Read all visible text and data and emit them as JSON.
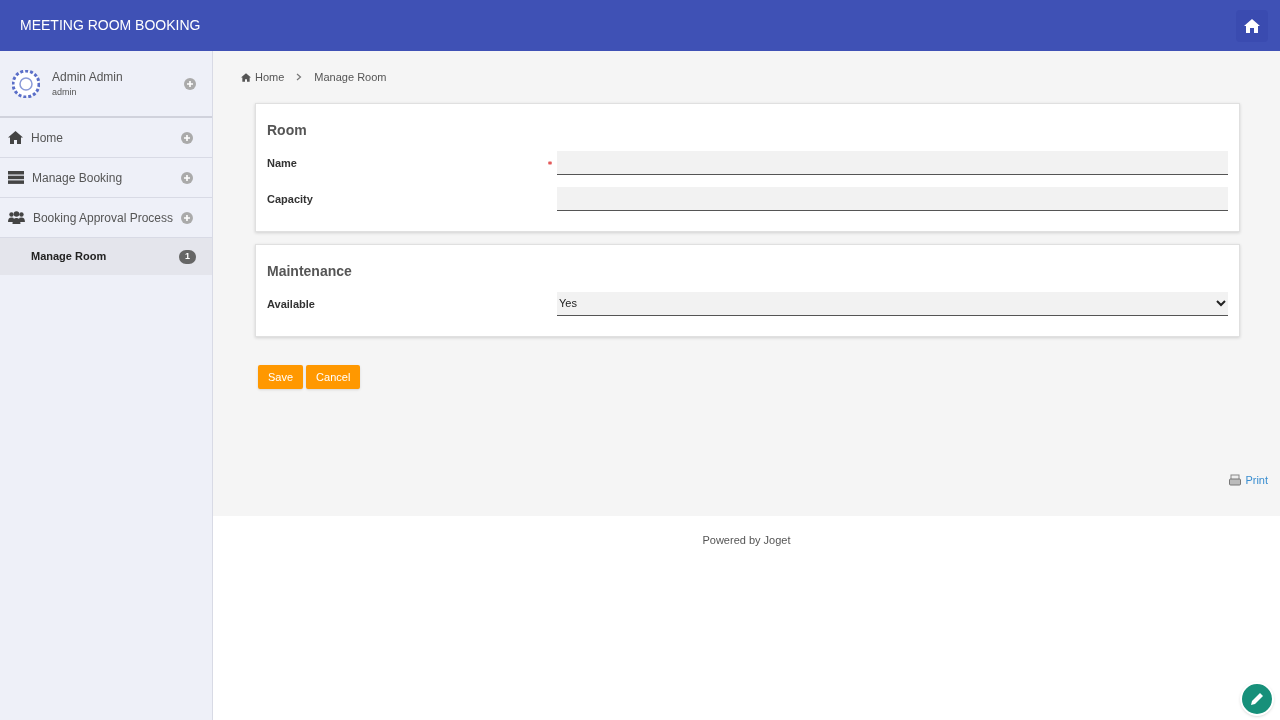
{
  "header": {
    "title": "MEETING ROOM BOOKING"
  },
  "user": {
    "name": "Admin Admin",
    "username": "admin"
  },
  "sidebar": {
    "items": [
      {
        "kind": "home",
        "label": "Home",
        "selected": false
      },
      {
        "kind": "booking",
        "label": "Manage Booking",
        "selected": false
      },
      {
        "kind": "people",
        "label": "Booking Approval Process",
        "selected": false
      },
      {
        "kind": "plain",
        "label": "Manage Room",
        "selected": true,
        "badge": "1"
      }
    ]
  },
  "breadcrumb": [
    "Home",
    "Manage Room"
  ],
  "sections": [
    {
      "title": "Room",
      "fields": [
        {
          "kind": "text",
          "label": "Name",
          "required": true
        },
        {
          "kind": "text",
          "label": "Capacity",
          "required": false
        }
      ]
    },
    {
      "title": "Maintenance",
      "fields": [
        {
          "kind": "select",
          "label": "Available",
          "required": false,
          "value": "Yes"
        }
      ]
    }
  ],
  "buttons": [
    "Save",
    "Cancel"
  ],
  "print_link": "Print",
  "footer": "Powered by Joget"
}
